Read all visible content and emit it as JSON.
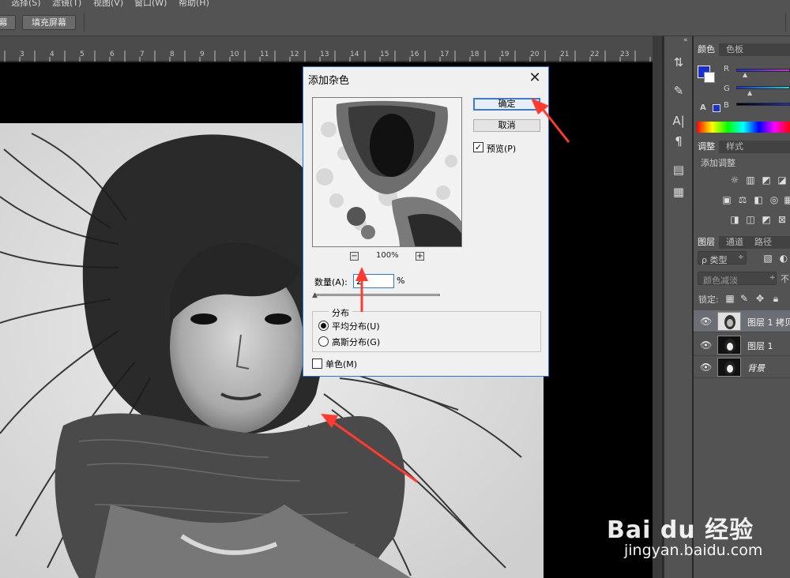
{
  "menu": {
    "items": [
      "选择(S)",
      "滤镜(T)",
      "视图(V)",
      "窗口(W)",
      "帮助(H)"
    ]
  },
  "options": {
    "partial_button": "幕",
    "fill_screen_button": "填充屏幕"
  },
  "ruler": {
    "labels": [
      "3",
      "4",
      "5",
      "6",
      "7",
      "8",
      "9",
      "10",
      "11",
      "12",
      "13",
      "14",
      "15",
      "16",
      "17",
      "18",
      "19",
      "20",
      "21",
      "22",
      "23"
    ]
  },
  "dialog": {
    "title": "添加杂色",
    "ok": "确定",
    "cancel": "取消",
    "preview_label": "预览(P)",
    "preview_checked": true,
    "zoom_out": "−",
    "zoom_in": "+",
    "zoom_level": "100%",
    "amount_label": "数量(A):",
    "amount_value": "2",
    "amount_unit": "%",
    "distribution_label": "分布",
    "uniform": "平均分布(U)",
    "gaussian": "高斯分布(G)",
    "selected_distribution": "uniform",
    "monochrome": "单色(M)",
    "monochrome_checked": false
  },
  "panels": {
    "color_tab": "颜色",
    "swatches_tab": "色板",
    "channel_r": "R",
    "channel_g": "G",
    "channel_b": "B",
    "foreground_color": "#1b2fd6",
    "adjust_tab": "调整",
    "styles_tab": "样式",
    "add_adjustment": "添加调整",
    "layers_tab": "图层",
    "channels_tab": "通道",
    "paths_tab": "路径",
    "filter_kind": "ρ 类型",
    "blend_mode": "颜色减淡",
    "blend_partial": "不",
    "lock_label": "锁定:",
    "layers": [
      {
        "name": "图层 1 拷贝",
        "selected": true
      },
      {
        "name": "图层 1",
        "selected": false
      },
      {
        "name": "背景",
        "selected": false
      }
    ]
  },
  "watermark": {
    "logo": "Bai du 经验",
    "url": "jingyan.baidu.com"
  }
}
